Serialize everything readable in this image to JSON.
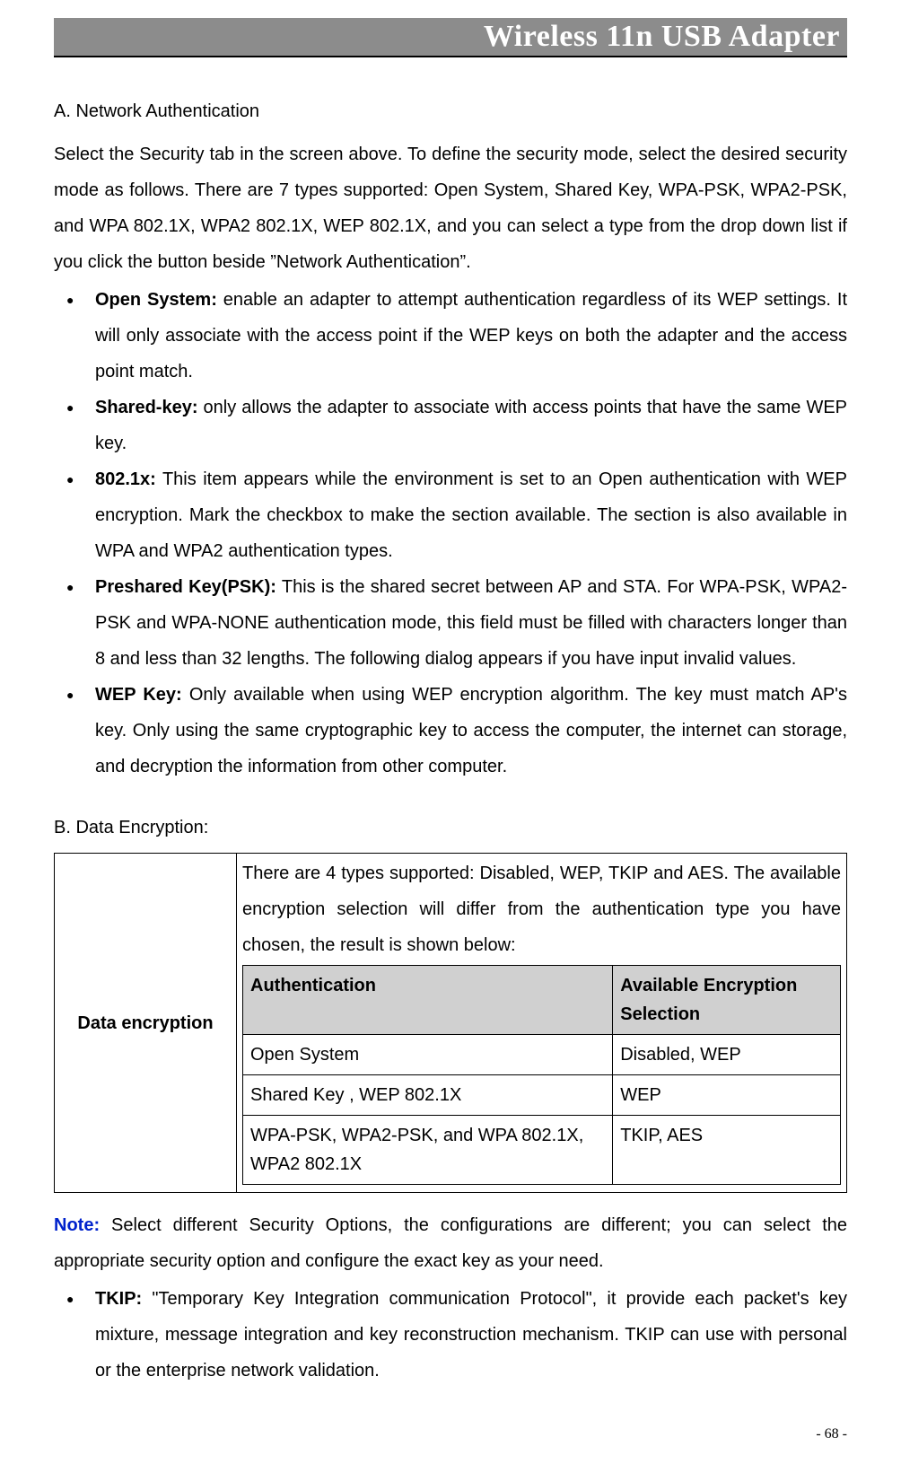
{
  "header": {
    "title": "Wireless 11n USB Adapter"
  },
  "sectionA": {
    "title": "A. Network Authentication",
    "intro": "Select the Security tab in the screen above. To define the security mode, select the desired security mode as follows. There are 7 types supported: Open System, Shared Key, WPA-PSK, WPA2-PSK, and WPA 802.1X, WPA2 802.1X, WEP 802.1X, and you can select a type from the drop down list if you click the button beside ”Network Authentication”.",
    "items": [
      {
        "label": "Open System:",
        "body": " enable an adapter to attempt authentication regardless of its WEP settings. It will only associate with the access point if the WEP keys on both the adapter and the access point match."
      },
      {
        "label": "Shared-key:",
        "body": " only allows the adapter to associate with access points that have the same WEP key."
      },
      {
        "label": "802.1x:",
        "body": " This item appears while the environment is set to an Open authentication with WEP encryption. Mark the checkbox to make the section available. The section is also available in WPA and WPA2 authentication types."
      },
      {
        "label": "Preshared Key(PSK):",
        "body": " This is the shared secret between AP and STA. For WPA-PSK, WPA2-PSK and WPA-NONE authentication mode, this field must be filled with characters longer than 8 and less than 32 lengths. The following dialog appears if you have input invalid values."
      },
      {
        "label": "WEP Key:",
        "body": " Only available when using WEP encryption algorithm. The key must match AP's key. Only using the same cryptographic key to access the computer, the internet can storage, and decryption the information from other computer."
      }
    ]
  },
  "sectionB": {
    "title": "B. Data Encryption:",
    "row_label": "Data encryption",
    "desc": "There are 4 types supported: Disabled, WEP, TKIP and AES. The available encryption selection will differ from the authentication type you have chosen, the result is shown below:",
    "table_headers": {
      "auth": "Authentication",
      "enc": "Available Encryption Selection"
    },
    "table_rows": [
      {
        "auth": "Open System",
        "enc": "Disabled, WEP"
      },
      {
        "auth": "Shared Key , WEP 802.1X",
        "enc": "WEP"
      },
      {
        "auth": "WPA-PSK, WPA2-PSK, and WPA 802.1X, WPA2 802.1X",
        "enc": "TKIP, AES"
      }
    ]
  },
  "notes": {
    "label": "Note:",
    "body": " Select different Security Options, the configurations are different; you can select the appropriate security option and configure the exact key as your need.",
    "tkip_label": "TKIP:",
    "tkip_body": " \"Temporary Key Integration communication Protocol\", it provide each packet's key mixture, message integration and key reconstruction mechanism. TKIP can use with personal or the enterprise network validation."
  },
  "page_number": "- 68 -"
}
